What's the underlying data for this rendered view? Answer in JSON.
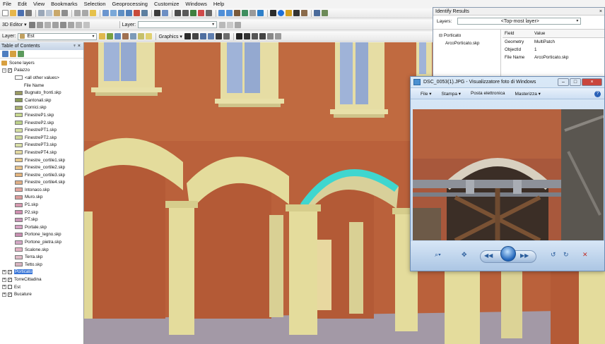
{
  "menu": [
    "File",
    "Edit",
    "View",
    "Bookmarks",
    "Selection",
    "Geoprocessing",
    "Customize",
    "Windows",
    "Help"
  ],
  "toolbar2": {
    "editor_label": "3D Editor",
    "layer_label": "Layer:",
    "layer_value": ""
  },
  "toolbar3": {
    "layer_label": "Layer:",
    "layer_value": "Est",
    "graphics_label": "Graphics"
  },
  "toc": {
    "title": "Table of Contents",
    "pin": "♆ ×",
    "scene_layers": "Scene layers",
    "group": "Palazzo",
    "other_values": "<all other values>",
    "field": "File Name",
    "items": [
      {
        "label": "Bugnato_fronti.skp",
        "color": "#9a9a62"
      },
      {
        "label": "Cantonali.skp",
        "color": "#8a9a5a"
      },
      {
        "label": "Cornici.skp",
        "color": "#a9b070"
      },
      {
        "label": "FinestreP1.skp",
        "color": "#c8d890"
      },
      {
        "label": "FinestreP2.skp",
        "color": "#bcd08a"
      },
      {
        "label": "FinestrePT1.skp",
        "color": "#d6e0a4"
      },
      {
        "label": "FinestrePT2.skp",
        "color": "#cfd99c"
      },
      {
        "label": "FinestrePT3.skp",
        "color": "#d9dfa8"
      },
      {
        "label": "FinestrePT4.skp",
        "color": "#e2d8a0"
      },
      {
        "label": "Finestre_cortile1.skp",
        "color": "#e6c98e"
      },
      {
        "label": "Finestre_cortile2.skp",
        "color": "#e8c28a"
      },
      {
        "label": "Finestre_cortile3.skp",
        "color": "#e3b47e"
      },
      {
        "label": "Finestre_cortile4.skp",
        "color": "#dfae86"
      },
      {
        "label": "Intonaco.skp",
        "color": "#e4a6a0"
      },
      {
        "label": "Muro.skp",
        "color": "#dc9c9c"
      },
      {
        "label": "P1.skp",
        "color": "#d79ab0"
      },
      {
        "label": "P2.skp",
        "color": "#cf8fb0"
      },
      {
        "label": "PT.skp",
        "color": "#c996b8"
      },
      {
        "label": "Portale.skp",
        "color": "#d6a2c4"
      },
      {
        "label": "Portone_legno.skp",
        "color": "#c88fb2"
      },
      {
        "label": "Portone_pietra.skp",
        "color": "#d4a8c6"
      },
      {
        "label": "Scalone.skp",
        "color": "#e6b2c4"
      },
      {
        "label": "Terra.skp",
        "color": "#e0bcc8"
      },
      {
        "label": "Tetto.skp",
        "color": "#d8b4c0"
      }
    ],
    "bottom": [
      "Porticato",
      "TorreCittadina",
      "Est",
      "Bucature"
    ]
  },
  "identify": {
    "title": "Identify Results",
    "close": "×",
    "layers_label": "Layers:",
    "layers_value": "<Top-most layer>",
    "tree": [
      "Porticato",
      "ArcoPorticato.skp"
    ],
    "headers": [
      "Field",
      "Value"
    ],
    "rows": [
      [
        "Geometry",
        "MultiPatch"
      ],
      [
        "ObjectId",
        "1"
      ],
      [
        "File Name",
        "ArcoPorticato.skp"
      ]
    ]
  },
  "viewer": {
    "title": "DSC_0053(1).JPG - Visualizzatore foto di Windows",
    "menu": [
      "File ▾",
      "Stampa ▾",
      "Posta elettronica",
      "Masterizza ▾"
    ],
    "help": "?"
  },
  "colors": {
    "wall": "#b8603c",
    "stone": "#e4dc9c",
    "ground": "#a399a6",
    "highlight": "#3fd6cf",
    "selection": "#3875d7"
  }
}
